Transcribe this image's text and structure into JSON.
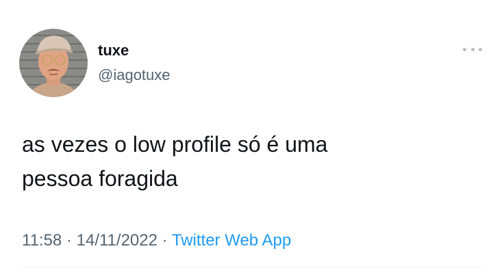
{
  "author": {
    "name": "tuxe",
    "handle": "@iagotuxe",
    "avatar_icon": "profile-photo"
  },
  "menu": {
    "icon": "more-options-icon"
  },
  "tweet": {
    "text": "as vezes o low profile só é uma\npessoa foragida",
    "time": "11:58",
    "separator": "·",
    "date": "14/11/2022",
    "source": "Twitter Web App"
  },
  "colors": {
    "text": "#0f1419",
    "secondary": "#536471",
    "link": "#1d9bf0",
    "divider": "#eff3f4"
  }
}
